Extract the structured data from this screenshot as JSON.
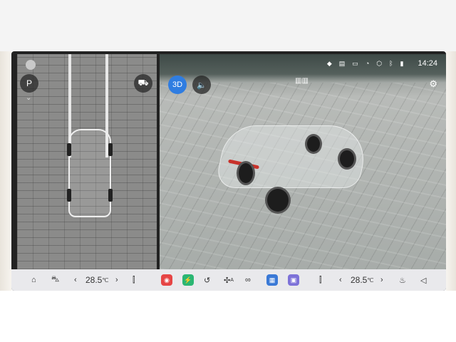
{
  "status_bar": {
    "time": "14:24",
    "icons": [
      "location-icon",
      "connected-device-icon",
      "camera-icon",
      "notification-icon",
      "shield-icon",
      "bluetooth-icon",
      "signal-icon"
    ]
  },
  "left_panel": {
    "park_button_label": "P",
    "view_button_label": "⛟"
  },
  "right_panel": {
    "view_3d_label": "3D",
    "sound_label": "🔈"
  },
  "dock": {
    "left_temp": "28.5",
    "left_temp_unit": "℃",
    "right_temp": "28.5",
    "right_temp_unit": "℃",
    "home_icon": "⌂",
    "car_icon": "⛍",
    "chevron_left": "‹",
    "chevron_right": "›",
    "seat_icon": "⫿",
    "apps": [
      {
        "name": "record-app",
        "glyph": "◉",
        "color": "#e64545"
      },
      {
        "name": "energy-app",
        "glyph": "⚡",
        "color": "#2bb673"
      },
      {
        "name": "defrost-app",
        "glyph": "↺",
        "color": "#00000000"
      },
      {
        "name": "fan-app",
        "glyph": "✣",
        "color": "#00000000"
      },
      {
        "name": "recirculation-app",
        "glyph": "∞",
        "color": "#00000000"
      },
      {
        "name": "grid-app",
        "glyph": "▦",
        "color": "#3a79d6"
      },
      {
        "name": "media-app",
        "glyph": "▣",
        "color": "#7d72d8"
      }
    ],
    "fan_auto_label": "A",
    "heater_icon": "♨",
    "volume_icon": "◁"
  }
}
